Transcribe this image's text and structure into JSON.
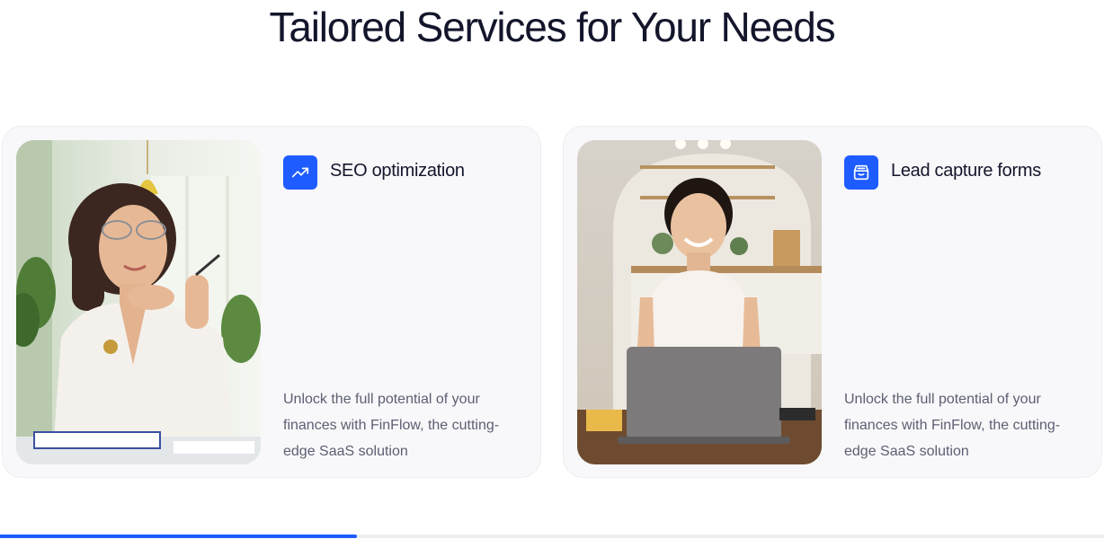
{
  "section": {
    "title": "Tailored Services for Your Needs"
  },
  "cards": [
    {
      "icon": "trending-up-icon",
      "title": "SEO optimization",
      "description": "Unlock the full potential of your finances with FinFlow, the cutting-edge SaaS solution",
      "image": "woman-with-glasses-thinking-photo"
    },
    {
      "icon": "inbox-tray-icon",
      "title": "Lead capture forms",
      "description": "Unlock the full potential of your finances with FinFlow, the cutting-edge SaaS solution",
      "image": "woman-smiling-at-laptop-photo"
    }
  ],
  "slider": {
    "progress_fraction": 0.323
  },
  "colors": {
    "accent": "#1f5cff",
    "title_text": "#13162b",
    "body_text": "#5c5f72",
    "card_background": "#f8f8fa"
  }
}
